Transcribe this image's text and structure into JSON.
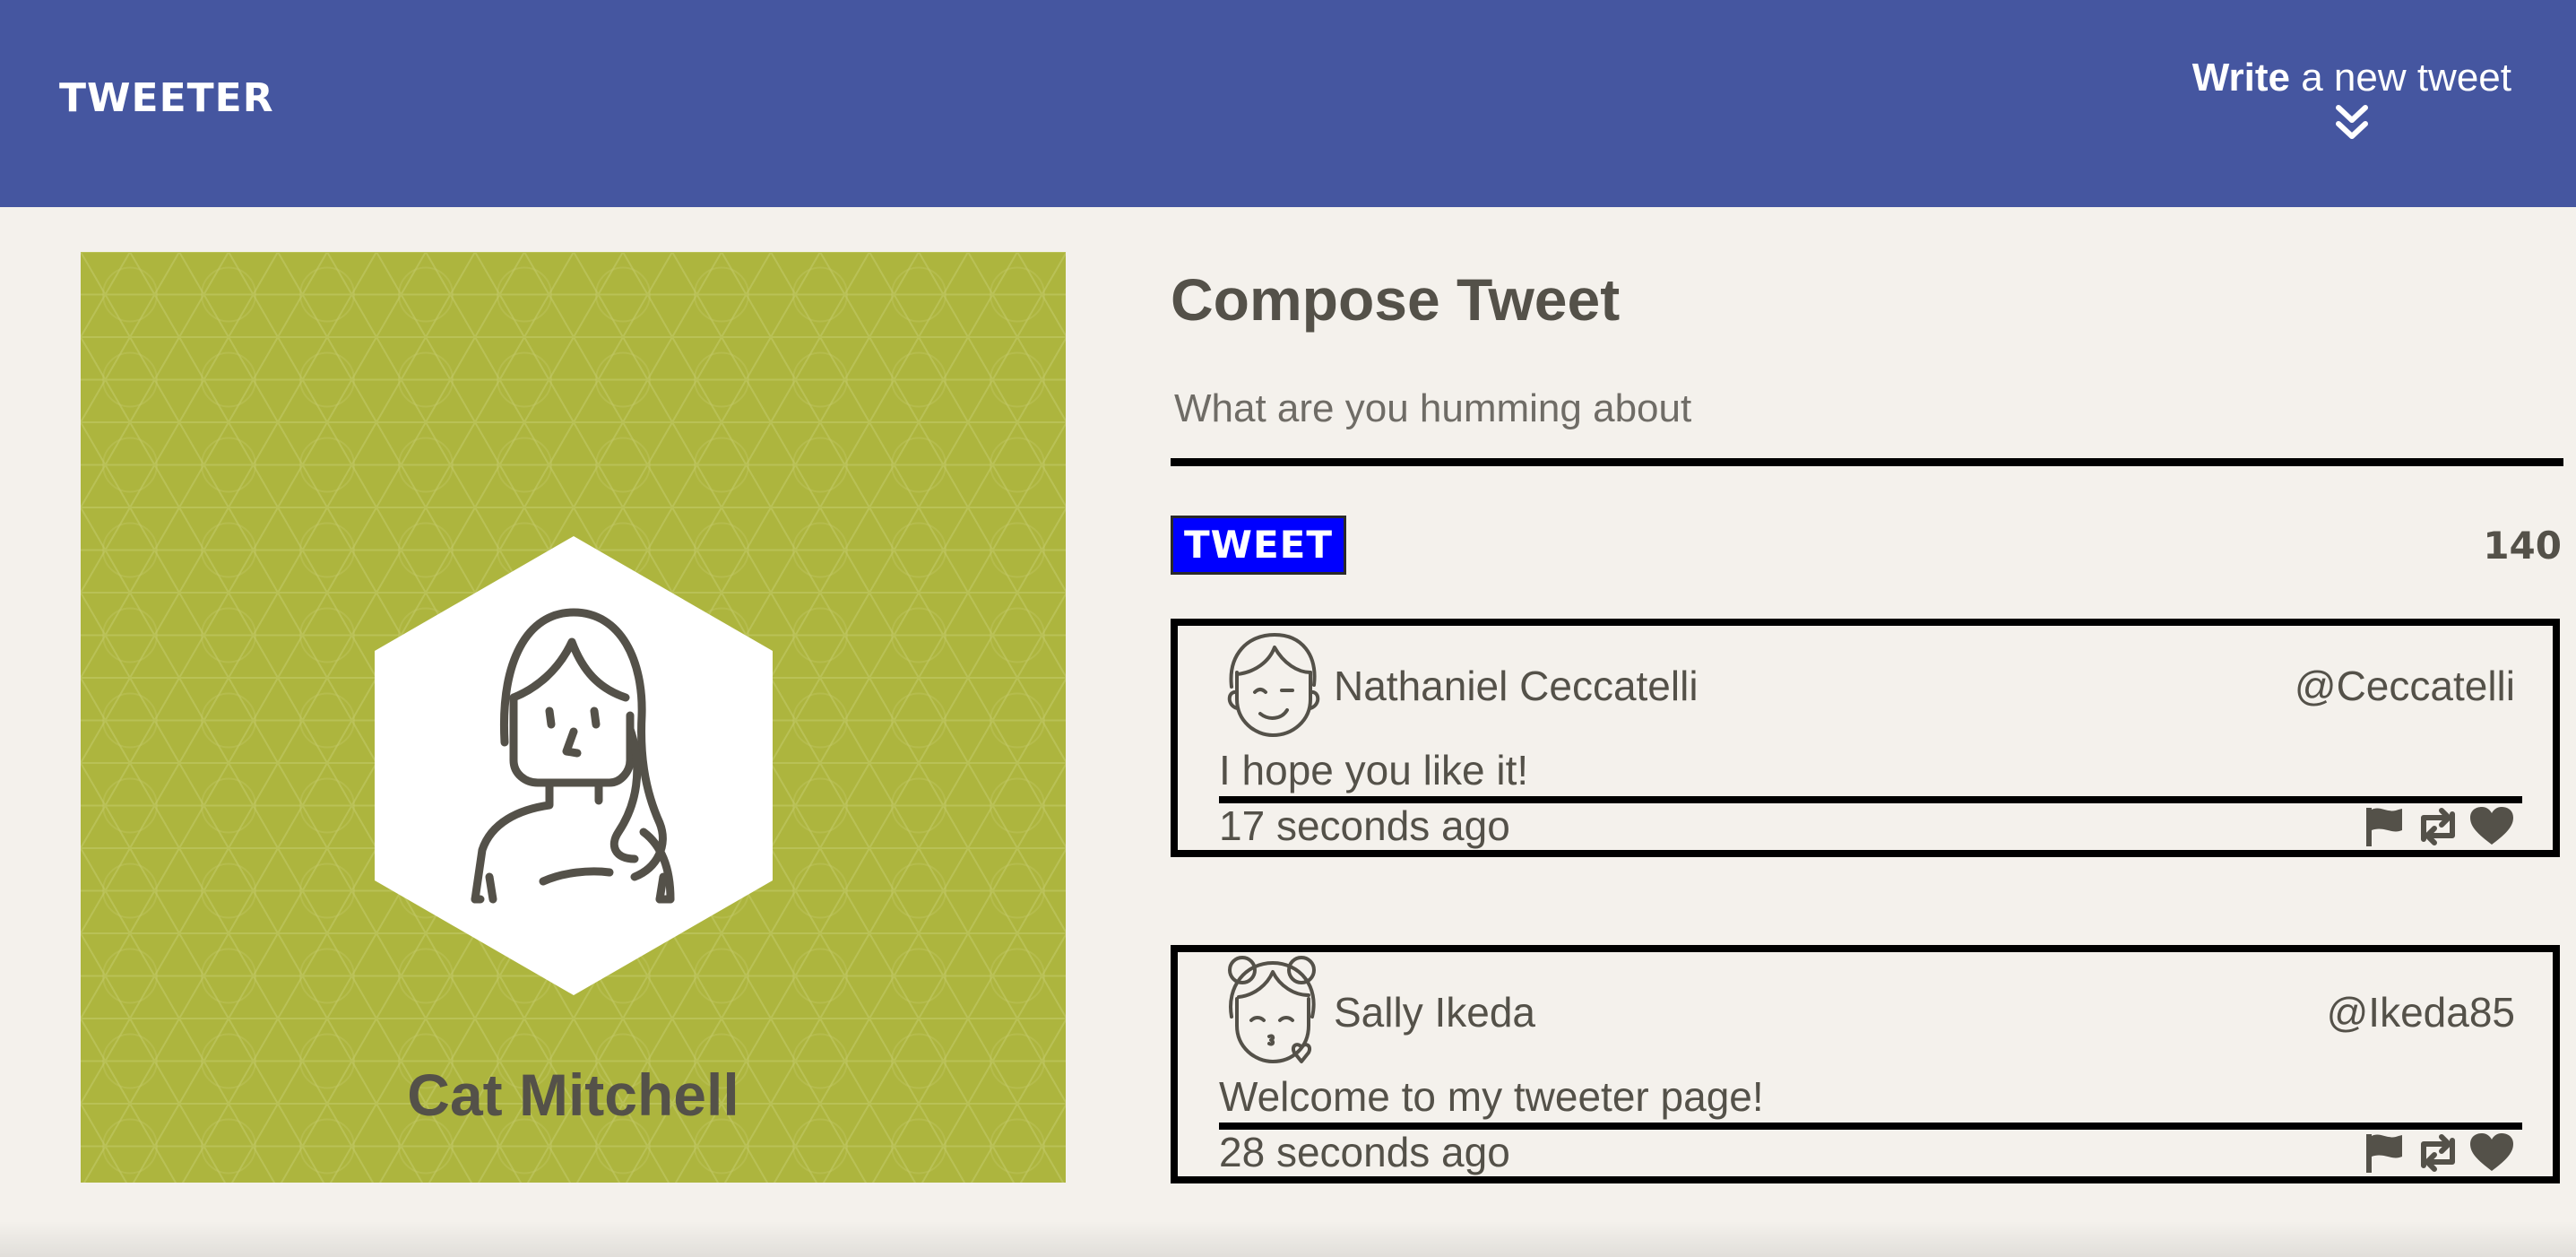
{
  "nav": {
    "logo": "TWEETER",
    "write_bold": "Write",
    "write_rest": " a new tweet",
    "chevron_icon": "double-chevron-down-icon"
  },
  "profile": {
    "name": "Cat Mitchell",
    "background_color": "#adb53e",
    "avatar_icon": "woman-avatar-icon"
  },
  "compose": {
    "title": "Compose Tweet",
    "placeholder": "What are you humming about",
    "button_label": "TWEET",
    "counter": "140"
  },
  "tweets": [
    {
      "name": "Nathaniel Ceccatelli",
      "handle": "@Ceccatelli",
      "content": "I hope you like it!",
      "time": "17 seconds ago",
      "avatar_icon": "boy-avatar-icon"
    },
    {
      "name": "Sally Ikeda",
      "handle": "@Ikeda85",
      "content": "Welcome to my tweeter page!",
      "time": "28 seconds ago",
      "avatar_icon": "girl-kiss-avatar-icon"
    }
  ],
  "actions": [
    "flag-icon",
    "retweet-icon",
    "heart-icon"
  ],
  "colors": {
    "nav": "#4556a0",
    "background": "#f4f1ec",
    "text": "#545149",
    "button": "#0000ff"
  }
}
